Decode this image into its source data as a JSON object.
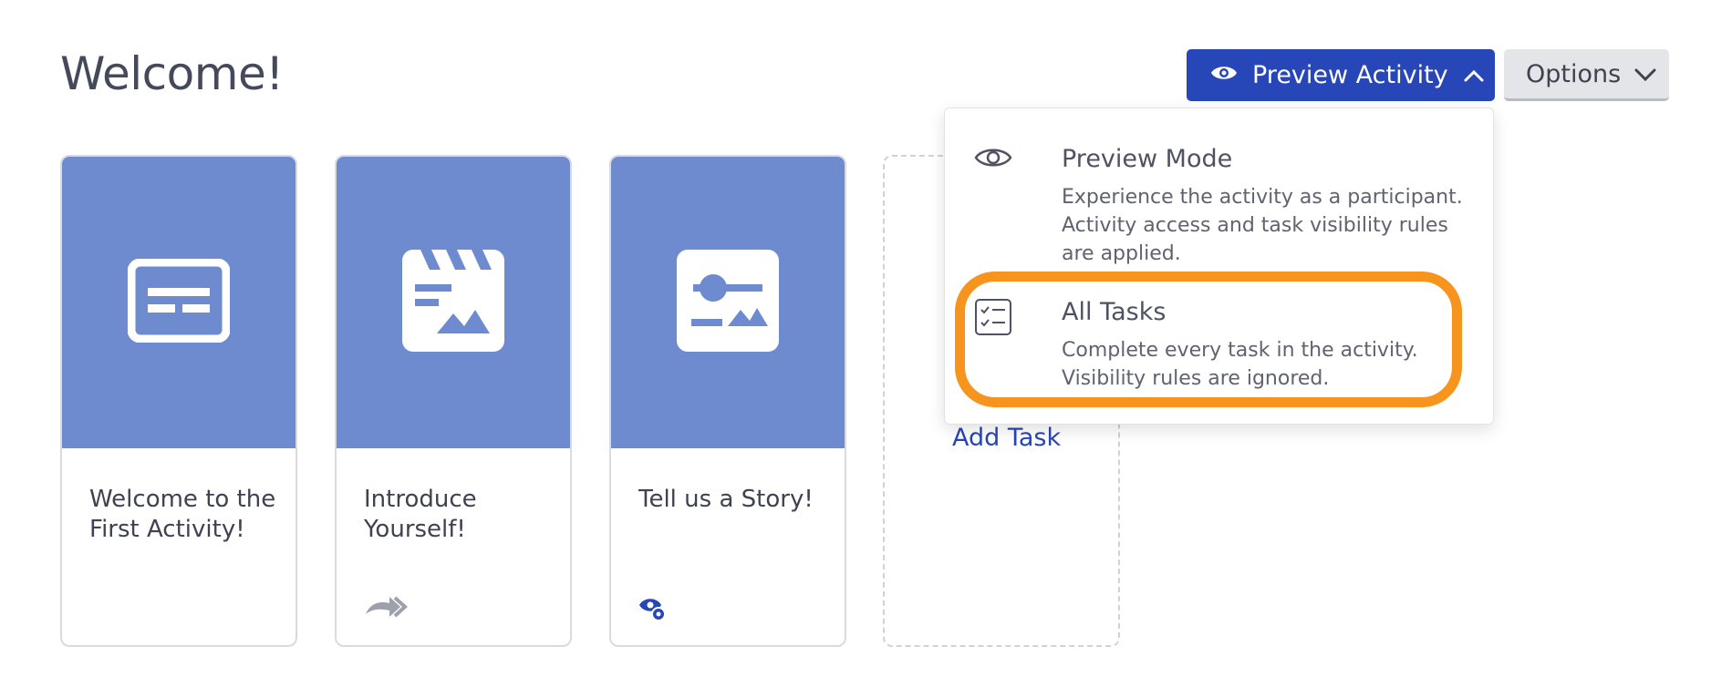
{
  "page": {
    "title": "Welcome!"
  },
  "header": {
    "preview_button": {
      "label": "Preview Activity",
      "icon": "eye-icon",
      "caret": "chevron-up-icon",
      "color": "#2746b8"
    },
    "options_button": {
      "label": "Options",
      "caret": "chevron-down-icon"
    }
  },
  "dropdown": {
    "items": [
      {
        "icon": "eye-icon",
        "title": "Preview Mode",
        "desc_lines": [
          "Experience the activity as a participant.",
          "Activity access and task visibility rules",
          "are applied."
        ]
      },
      {
        "icon": "checklist-icon",
        "title": "All Tasks",
        "desc_lines": [
          "Complete every task in the activity.",
          "Visibility rules are ignored."
        ],
        "highlighted": true
      }
    ]
  },
  "tasks": [
    {
      "icon": "text-card-icon",
      "title_lines": [
        "Welcome to the",
        "First Activity!"
      ]
    },
    {
      "icon": "video-clapper-icon",
      "title_lines": [
        "Introduce",
        "Yourself!"
      ],
      "badge": "double-arrow-icon"
    },
    {
      "icon": "media-slider-icon",
      "title_lines": [
        "Tell us a Story!"
      ],
      "badge": "eye-gear-icon"
    }
  ],
  "add_task": {
    "label": "Add Task"
  },
  "colors": {
    "card_header": "#6f8bcf",
    "accent": "#2746b8",
    "highlight": "#f7941d"
  }
}
